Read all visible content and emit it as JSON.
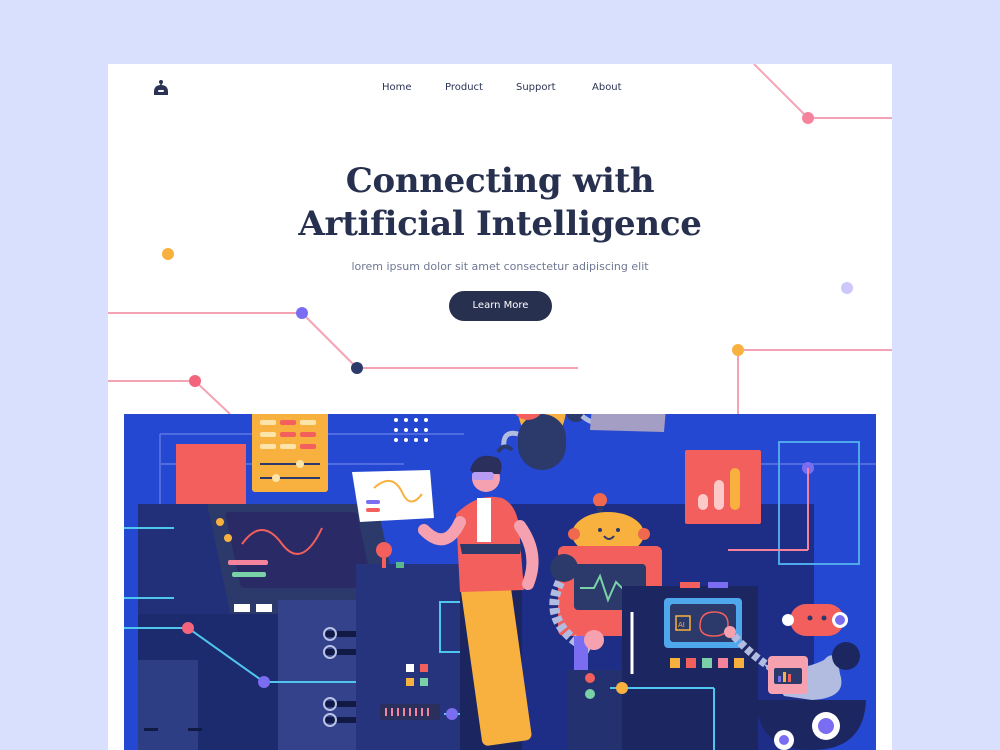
{
  "nav": {
    "logo_icon": "robot-head-icon",
    "items": [
      {
        "label": "Home"
      },
      {
        "label": "Product"
      },
      {
        "label": "Support"
      },
      {
        "label": "About"
      }
    ]
  },
  "hero": {
    "title_line1": "Connecting with",
    "title_line2": "Artificial Intelligence",
    "subtitle": "lorem ipsum dolor sit amet consectetur adipiscing elit",
    "cta_label": "Learn More"
  },
  "illustration": {
    "chip_label": "AI",
    "icons": [
      "robot-icon",
      "calculator-icon",
      "bar-chart-icon",
      "screen-icon",
      "brain-icon",
      "chip-icon"
    ]
  },
  "colors": {
    "page_background": "#d8e0fd",
    "card_background": "#ffffff",
    "heading": "#27304f",
    "illustration_blue": "#2448d1",
    "accent_pink": "#f4839b",
    "accent_yellow": "#f8b13f",
    "accent_purple": "#7b6df2",
    "accent_red": "#f25f5c"
  }
}
